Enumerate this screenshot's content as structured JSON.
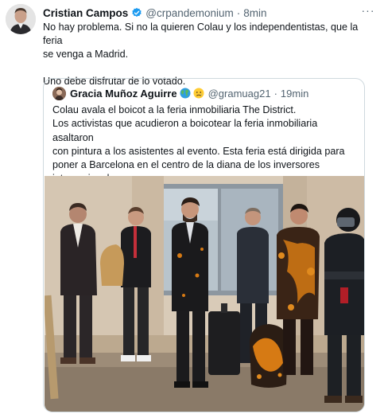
{
  "tweet": {
    "author_name": "Cristian Campos",
    "handle": "@crpandemonium",
    "separator": "·",
    "time": "8min",
    "more_label": "···",
    "text_lines": [
      "No hay problema. Si no la quieren Colau y los independentistas, que la feria",
      "se venga a Madrid.",
      "Uno debe disfrutar de lo votado."
    ]
  },
  "quote": {
    "author_name": "Gracia Muñoz Aguirre",
    "handle": "@gramuag21",
    "separator": "·",
    "time": "19min",
    "text_lines": [
      "Colau avala el boicot a la feria inmobiliaria The District.",
      "Los activistas que acudieron a boicotear la feria inmobiliaria asaltaron",
      "con pintura a los asistentes al evento. Esta feria está dirigida para",
      "poner a Barcelona en el centro de la diana de los inversores",
      "internacionales."
    ],
    "emojis": [
      "globe-icon",
      "worried-face-icon"
    ]
  },
  "colors": {
    "text": "#0f1419",
    "secondary": "#536471",
    "border": "#cfd9de",
    "verified": "#1d9bf0",
    "paint": "#d67a14"
  }
}
